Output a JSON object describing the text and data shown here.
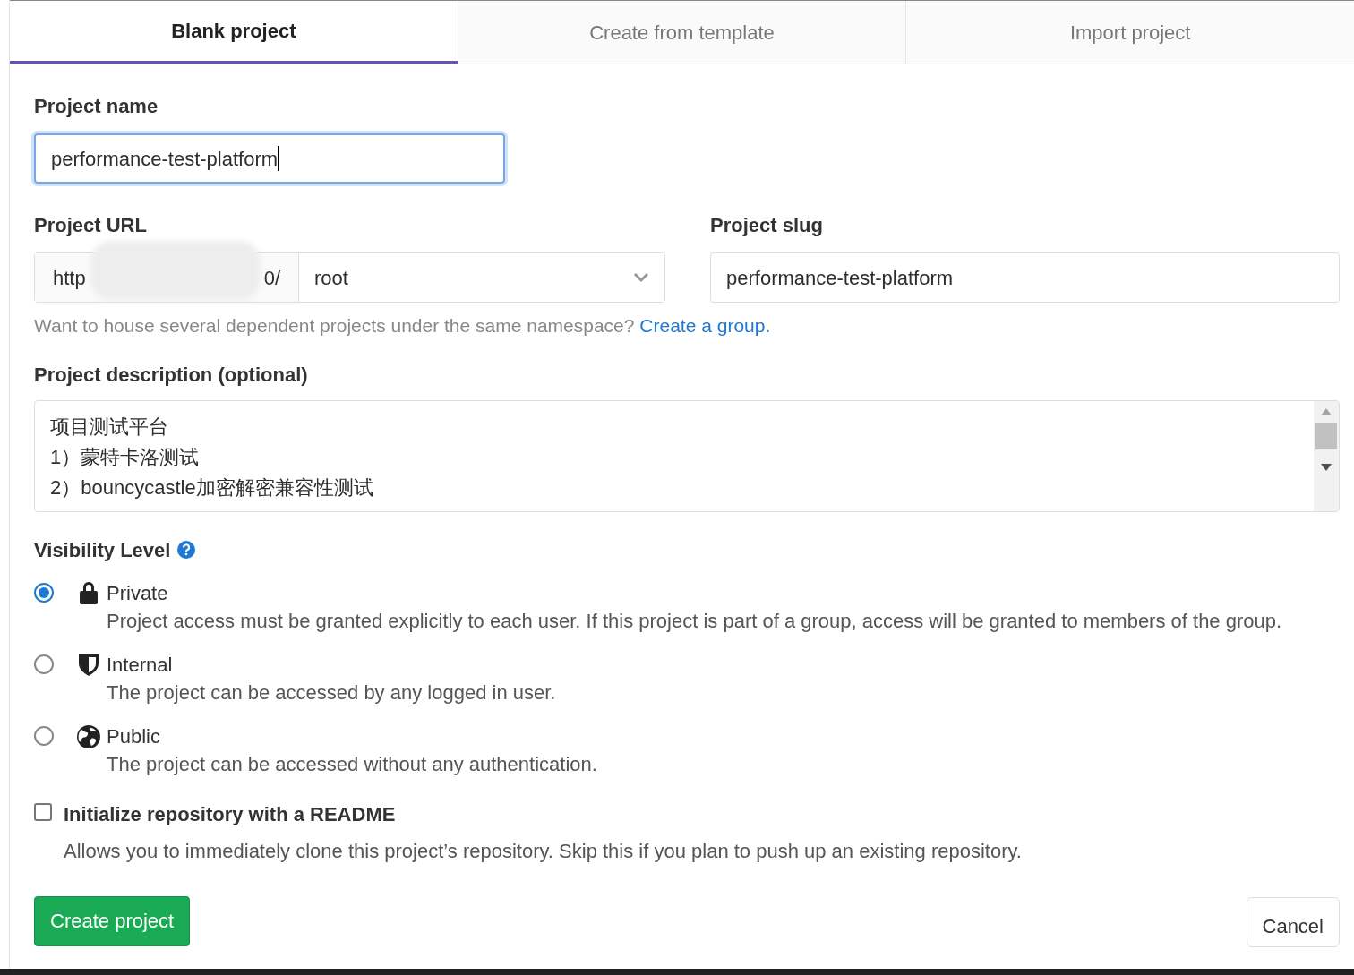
{
  "tabs": [
    {
      "label": "Blank project",
      "selected": true
    },
    {
      "label": "Create from template",
      "selected": false
    },
    {
      "label": "Import project",
      "selected": false
    }
  ],
  "project_name": {
    "label": "Project name",
    "value": "performance-test-platform",
    "focused": true
  },
  "project_url": {
    "label": "Project URL",
    "prefix_start": "http",
    "prefix_end": "0/",
    "namespace": "root"
  },
  "project_slug": {
    "label": "Project slug",
    "value": "performance-test-platform"
  },
  "namespace_hint": {
    "text": "Want to house several dependent projects under the same namespace?",
    "link": "Create a group."
  },
  "description": {
    "label": "Project description (optional)",
    "lines": [
      "项目测试平台",
      "1）蒙特卡洛测试",
      "2）bouncycastle加密解密兼容性测试"
    ]
  },
  "visibility": {
    "label": "Visibility Level",
    "options": [
      {
        "kind": "lock",
        "title": "Private",
        "description": "Project access must be granted explicitly to each user. If this project is part of a group, access will be granted to members of the group.",
        "selected": true
      },
      {
        "kind": "shield",
        "title": "Internal",
        "description": "The project can be accessed by any logged in user.",
        "selected": false
      },
      {
        "kind": "globe",
        "title": "Public",
        "description": "The project can be accessed without any authentication.",
        "selected": false
      }
    ]
  },
  "readme": {
    "label": "Initialize repository with a README",
    "description": "Allows you to immediately clone this project’s repository. Skip this if you plan to push up an existing repository.",
    "checked": false
  },
  "buttons": {
    "create": "Create project",
    "cancel": "Cancel"
  }
}
